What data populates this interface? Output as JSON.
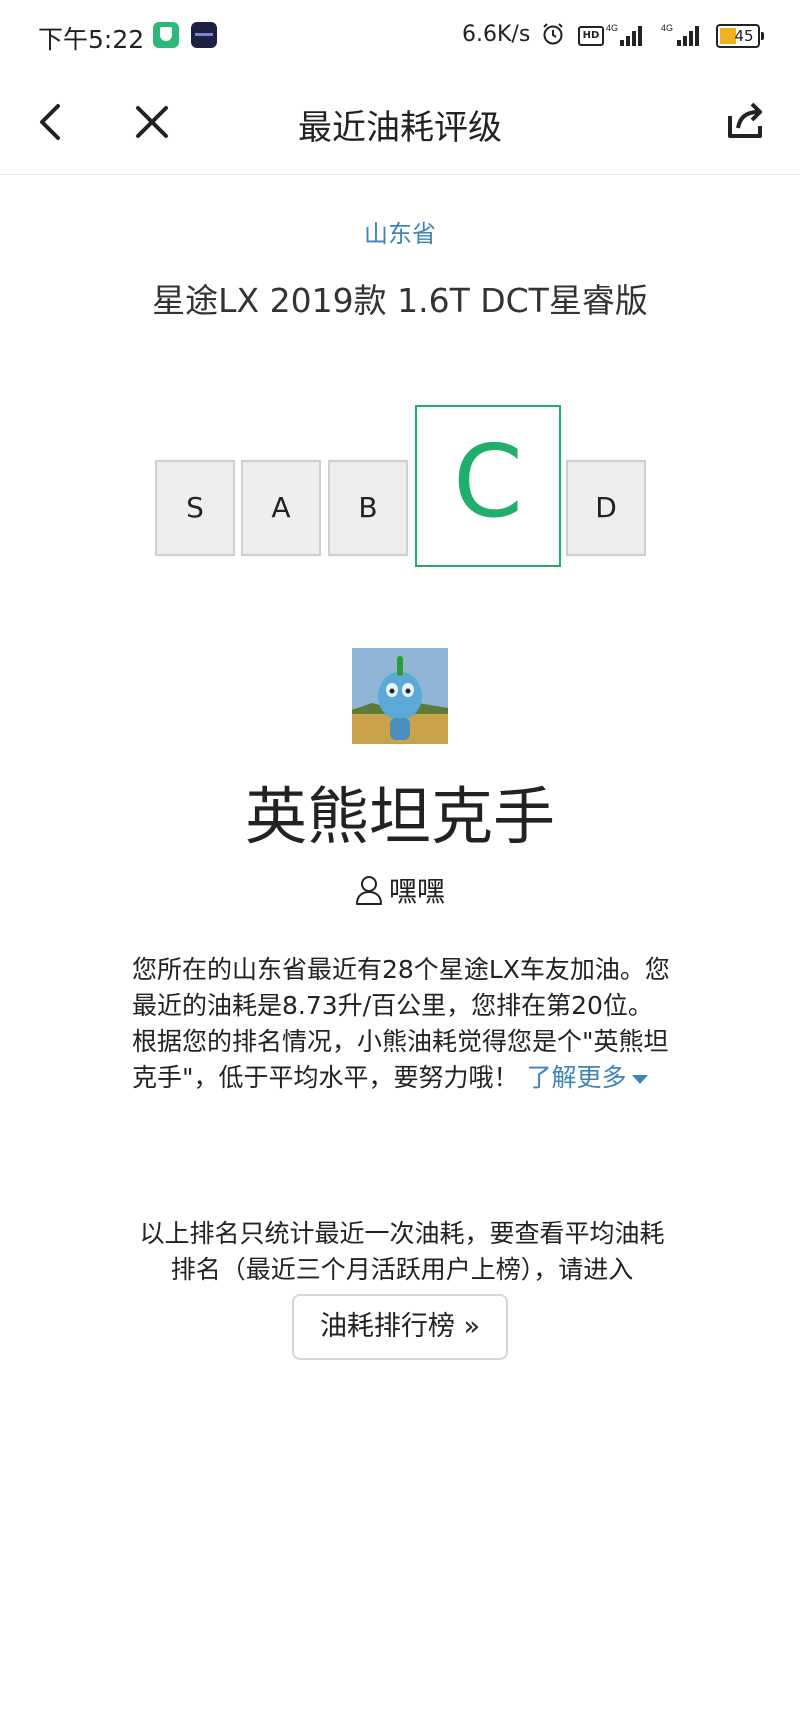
{
  "status_bar": {
    "time": "下午5:22",
    "net_speed": "6.6K/s",
    "hd": "HD",
    "signal_label": "4G",
    "battery": "45",
    "icons": [
      "app-shield-icon",
      "app-dark-icon",
      "alarm-icon",
      "hd-icon",
      "signal-4g-icon",
      "signal-4g-icon",
      "battery-icon"
    ]
  },
  "nav": {
    "title": "最近油耗评级",
    "back_icon": "chevron-left-icon",
    "close_icon": "close-icon",
    "share_icon": "share-icon"
  },
  "header": {
    "province": "山东省",
    "car_model": "星途LX 2019款 1.6T DCT星睿版"
  },
  "grades": {
    "items": [
      "S",
      "A",
      "B",
      "C",
      "D"
    ],
    "active": "C",
    "active_color": "#1fae6b"
  },
  "result": {
    "honor_title": "英熊坦克手",
    "user_name": "嘿嘿",
    "description": "您所在的山东省最近有28个星途LX车友加油。您最近的油耗是8.73升/百公里，您排在第20位。根据您的排名情况，小熊油耗觉得您是个\"英熊坦克手\"，低于平均水平，要努力哦！",
    "more_label": "了解更多"
  },
  "footer": {
    "note": "以上排名只统计最近一次油耗，要查看平均油耗排名（最近三个月活跃用户上榜），请进入",
    "button_label": "油耗排行榜 »"
  },
  "colors": {
    "accent_green": "#1fae6b",
    "link_blue": "#3f84b8"
  }
}
